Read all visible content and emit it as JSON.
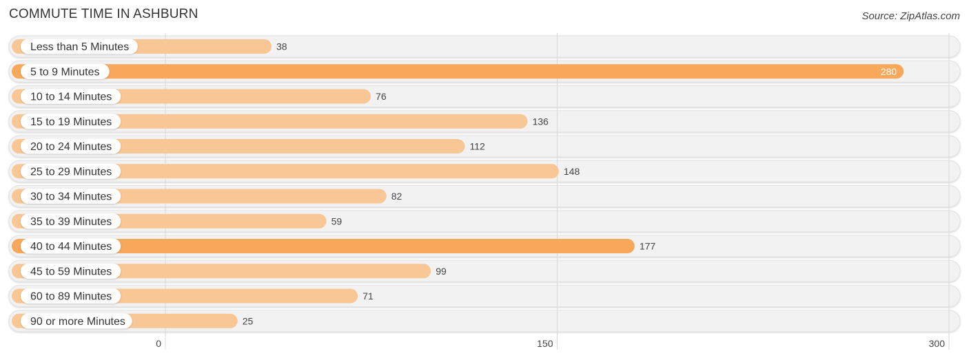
{
  "chart_data": {
    "type": "bar",
    "orientation": "horizontal",
    "title": "COMMUTE TIME IN ASHBURN",
    "source": "Source: ZipAtlas.com",
    "categories": [
      "Less than 5 Minutes",
      "5 to 9 Minutes",
      "10 to 14 Minutes",
      "15 to 19 Minutes",
      "20 to 24 Minutes",
      "25 to 29 Minutes",
      "30 to 34 Minutes",
      "35 to 39 Minutes",
      "40 to 44 Minutes",
      "45 to 59 Minutes",
      "60 to 89 Minutes",
      "90 or more Minutes"
    ],
    "values": [
      38,
      280,
      76,
      136,
      112,
      148,
      82,
      59,
      177,
      99,
      71,
      25
    ],
    "xlim": [
      0,
      300
    ],
    "xticks": [
      0,
      150,
      300
    ],
    "xlabel": "",
    "ylabel": "",
    "grid": true,
    "legend": "none",
    "colors": {
      "bar": "#f9c795",
      "bar_highlight": "#f8a85a",
      "track": "#f2f2f2",
      "label_bg": "#ffffff"
    }
  }
}
